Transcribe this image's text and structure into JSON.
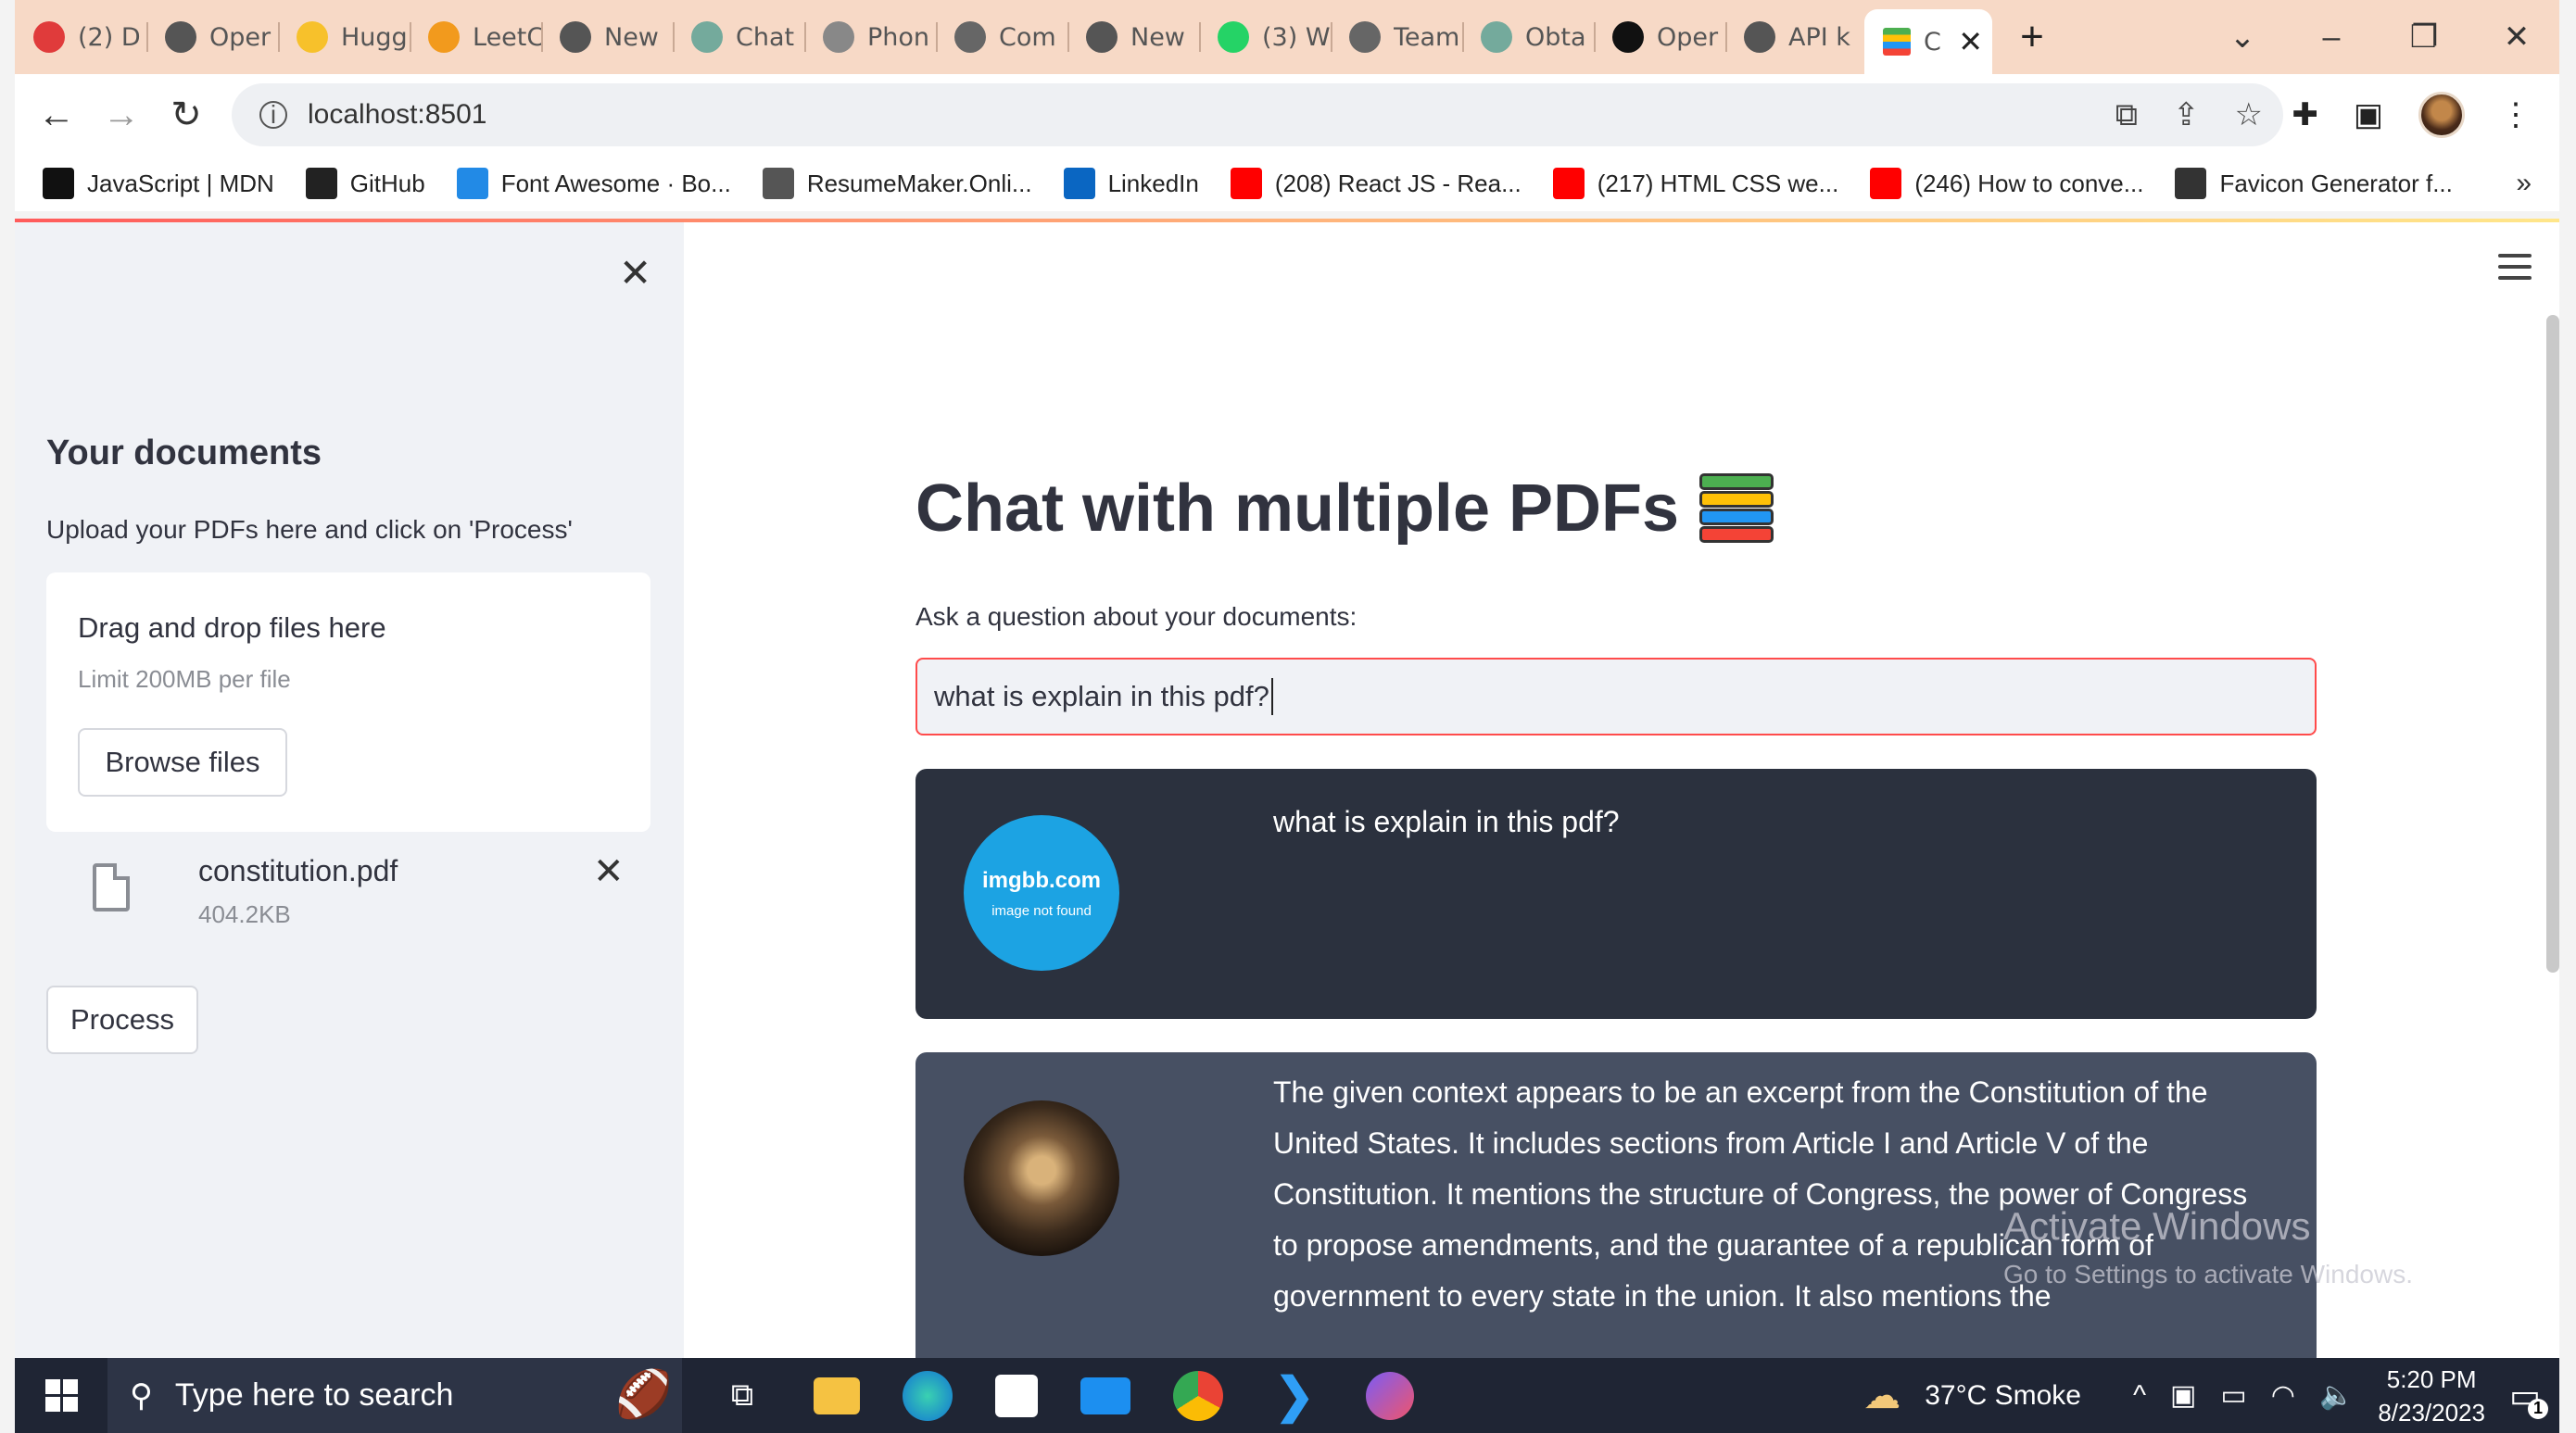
{
  "browser": {
    "tabs": [
      {
        "title": "(2) D",
        "icon": "red-circle-icon",
        "color": "#e03b3b"
      },
      {
        "title": "Oper",
        "icon": "openai-icon",
        "color": "#555555"
      },
      {
        "title": "Hugg",
        "icon": "huggingface-icon",
        "color": "#f7c12b"
      },
      {
        "title": "LeetC",
        "icon": "leetcode-icon",
        "color": "#f29a1d"
      },
      {
        "title": "New",
        "icon": "chrome-icon",
        "color": "#555555"
      },
      {
        "title": "Chat",
        "icon": "chatgpt-icon",
        "color": "#74aa9c"
      },
      {
        "title": "Phon",
        "icon": "book-icon",
        "color": "#888888"
      },
      {
        "title": "Com",
        "icon": "doc-icon",
        "color": "#666666"
      },
      {
        "title": "New",
        "icon": "chrome-icon",
        "color": "#555555"
      },
      {
        "title": "(3) W",
        "icon": "whatsapp-icon",
        "color": "#25d366"
      },
      {
        "title": "Team",
        "icon": "doc-icon",
        "color": "#666666"
      },
      {
        "title": "Obta",
        "icon": "chatgpt-icon",
        "color": "#74aa9c"
      },
      {
        "title": "Oper",
        "icon": "openai-icon",
        "color": "#111111"
      },
      {
        "title": "API k",
        "icon": "openai-icon",
        "color": "#555555"
      }
    ],
    "active_tab": {
      "title": "C",
      "icon": "books-icon"
    },
    "new_tab": "+",
    "address": "localhost:8501",
    "bookmarks": [
      {
        "label": "JavaScript | MDN",
        "icon": "mdn-icon",
        "color": "#111111"
      },
      {
        "label": "GitHub",
        "icon": "github-icon",
        "color": "#222222"
      },
      {
        "label": "Font Awesome · Bo...",
        "icon": "font-awesome-icon",
        "color": "#228ae6"
      },
      {
        "label": "ResumeMaker.Onli...",
        "icon": "resume-icon",
        "color": "#555555"
      },
      {
        "label": "LinkedIn",
        "icon": "linkedin-icon",
        "color": "#0a66c2"
      },
      {
        "label": "(208) React JS - Rea...",
        "icon": "youtube-icon",
        "color": "#ff0000"
      },
      {
        "label": "(217) HTML CSS we...",
        "icon": "youtube-icon",
        "color": "#ff0000"
      },
      {
        "label": "(246) How to conve...",
        "icon": "youtube-icon",
        "color": "#ff0000"
      },
      {
        "label": "Favicon Generator f...",
        "icon": "globe-icon",
        "color": "#333333"
      }
    ],
    "bookmarks_more": "»"
  },
  "sidebar": {
    "title": "Your documents",
    "description": "Upload your PDFs here and click on 'Process'",
    "uploader": {
      "title": "Drag and drop files here",
      "limit": "Limit 200MB per file",
      "browse_label": "Browse files"
    },
    "file": {
      "name": "constitution.pdf",
      "size": "404.2KB"
    },
    "process_label": "Process"
  },
  "main": {
    "title": "Chat with multiple PDFs",
    "question_label": "Ask a question about your documents:",
    "question_value": "what is explain in this pdf?",
    "messages": [
      {
        "role": "user",
        "avatar_line1": "imgbb.com",
        "avatar_line2": "image not found",
        "text": "what is explain in this pdf?"
      },
      {
        "role": "bot",
        "text": "The given context appears to be an excerpt from the Constitution of the United States. It includes sections from Article I and Article V of the Constitution. It mentions the structure of Congress, the power of Congress to propose amendments, and the guarantee of a republican form of government to every state in the union. It also mentions the"
      }
    ]
  },
  "watermark": {
    "line1": "Activate Windows",
    "line2": "Go to Settings to activate Windows."
  },
  "taskbar": {
    "search_placeholder": "Type here to search",
    "weather": "37°C  Smoke",
    "time": "5:20 PM",
    "date": "8/23/2023",
    "notification_count": "1"
  },
  "colors": {
    "accent": "#ff4b4b",
    "user_bubble": "#2b313e",
    "bot_bubble": "#475063",
    "sidebar": "#f0f2f6"
  }
}
